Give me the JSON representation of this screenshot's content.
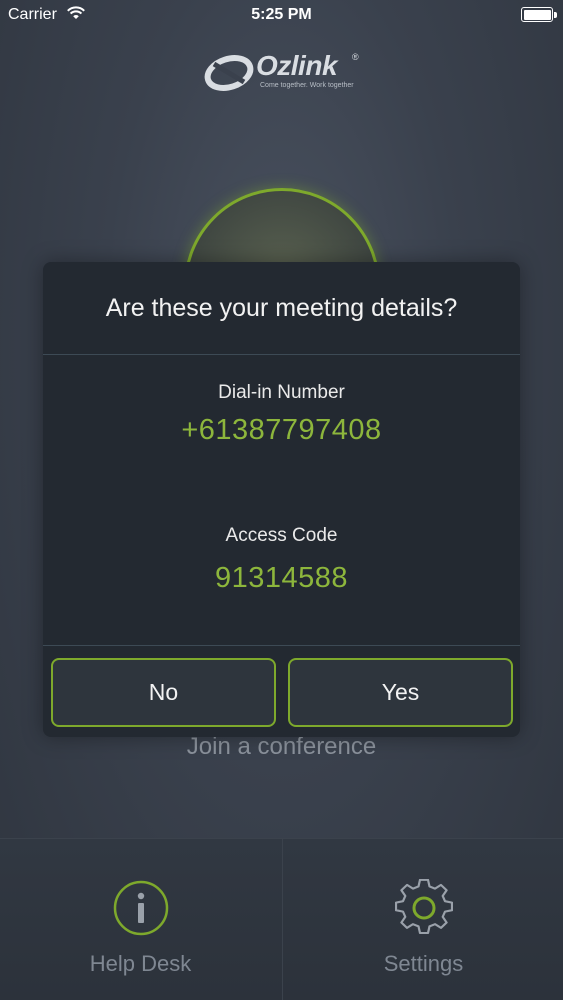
{
  "status_bar": {
    "carrier": "Carrier",
    "time": "5:25 PM",
    "battery_level": 1.0
  },
  "logo": {
    "brand": "Ozlink",
    "registered": "®",
    "tagline": "Come together. Work together"
  },
  "main": {
    "join_label": "Join a conference"
  },
  "dialog": {
    "title": "Are these your meeting details?",
    "dial_in_label": "Dial-in Number",
    "dial_in_value": "+61387797408",
    "access_code_label": "Access Code",
    "access_code_value": "91314588",
    "no_label": "No",
    "yes_label": "Yes"
  },
  "tabbar": {
    "items": [
      {
        "label": "Help Desk",
        "icon": "info-icon"
      },
      {
        "label": "Settings",
        "icon": "gear-icon"
      }
    ]
  },
  "colors": {
    "accent": "#8db63c",
    "border_accent": "#7ea92c",
    "dialog_bg": "#232931",
    "muted_text": "#7f8792"
  }
}
